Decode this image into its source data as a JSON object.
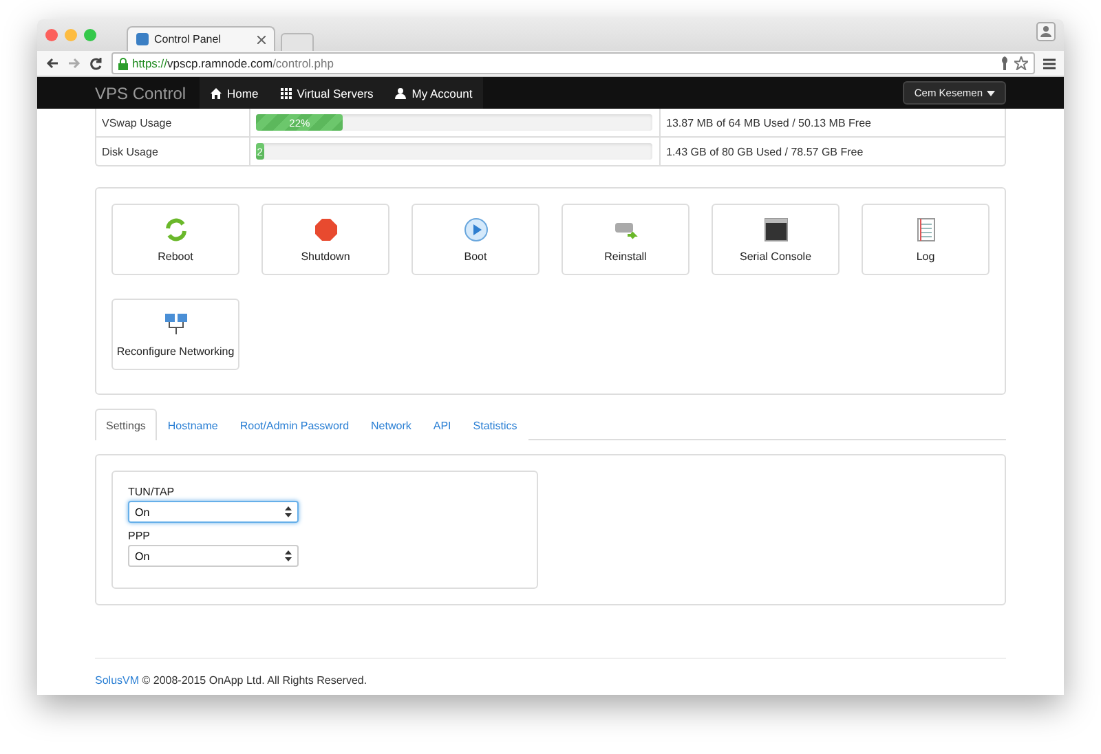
{
  "browser": {
    "tab_title": "Control Panel",
    "url": {
      "scheme": "https://",
      "host": "vpscp.ramnode.com",
      "path": "/control.php"
    }
  },
  "navbar": {
    "brand": "VPS Control",
    "links": [
      {
        "label": "Home",
        "kind": "home",
        "selected": true
      },
      {
        "label": "Virtual Servers",
        "kind": "grid",
        "selected": true
      },
      {
        "label": "My Account",
        "kind": "user",
        "selected": true
      }
    ],
    "user_menu": "Cem Kesemen"
  },
  "usage": [
    {
      "label": "VSwap Usage",
      "level": 0.22,
      "bar_label": "22%",
      "detail": "13.87 MB of 64 MB Used / 50.13 MB Free"
    },
    {
      "label": "Disk Usage",
      "level": 0.02,
      "bar_label": "2",
      "detail": "1.43 GB of 80 GB Used / 78.57 GB Free"
    }
  ],
  "actions": [
    {
      "label": "Reboot",
      "kind": "reboot"
    },
    {
      "label": "Shutdown",
      "kind": "shutdown"
    },
    {
      "label": "Boot",
      "kind": "boot"
    },
    {
      "label": "Reinstall",
      "kind": "reinstall"
    },
    {
      "label": "Serial Console",
      "kind": "console"
    },
    {
      "label": "Log",
      "kind": "log"
    },
    {
      "label": "Reconfigure Networking",
      "kind": "network"
    }
  ],
  "tabs": [
    {
      "label": "Settings",
      "selected": true
    },
    {
      "label": "Hostname",
      "selected": false
    },
    {
      "label": "Root/Admin Password",
      "selected": false
    },
    {
      "label": "Network",
      "selected": false
    },
    {
      "label": "API",
      "selected": false
    },
    {
      "label": "Statistics",
      "selected": false
    }
  ],
  "settings": [
    {
      "label": "TUN/TAP",
      "value": "On",
      "focused": true
    },
    {
      "label": "PPP",
      "value": "On",
      "focused": false
    }
  ],
  "footer": {
    "link": "SolusVM",
    "text": "© 2008-2015 OnApp Ltd. All Rights Reserved."
  }
}
